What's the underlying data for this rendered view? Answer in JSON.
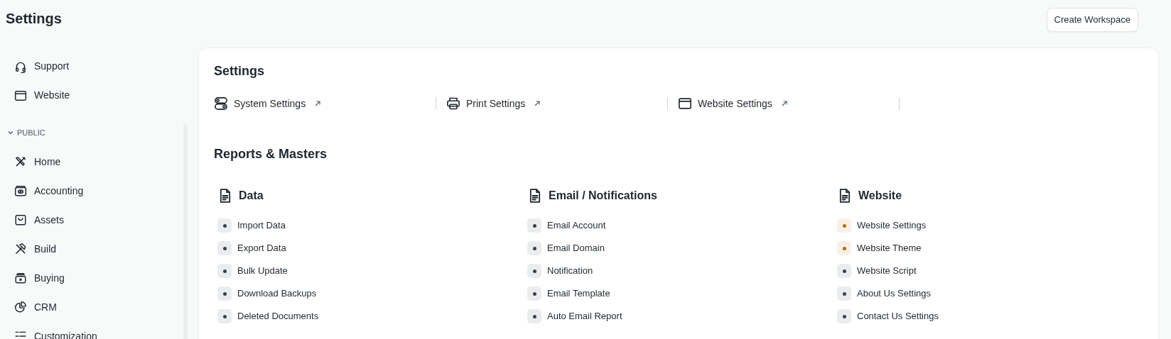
{
  "page_title": "Settings",
  "header_button": "Create Workspace",
  "sidebar": {
    "items": [
      {
        "label": "Support"
      },
      {
        "label": "Website"
      }
    ],
    "section": {
      "label": "PUBLIC",
      "expanded": true,
      "items": [
        {
          "label": "Home"
        },
        {
          "label": "Accounting"
        },
        {
          "label": "Assets"
        },
        {
          "label": "Build"
        },
        {
          "label": "Buying"
        },
        {
          "label": "CRM"
        },
        {
          "label": "Customization"
        }
      ]
    }
  },
  "card": {
    "title": "Settings",
    "shortcuts": [
      {
        "label": "System Settings"
      },
      {
        "label": "Print Settings"
      },
      {
        "label": "Website Settings"
      }
    ],
    "reports_title": "Reports & Masters",
    "groups": [
      {
        "title": "Data",
        "links": [
          {
            "label": "Import Data",
            "color": "#374151"
          },
          {
            "label": "Export Data",
            "color": "#374151"
          },
          {
            "label": "Bulk Update",
            "color": "#374151"
          },
          {
            "label": "Download Backups",
            "color": "#374151"
          },
          {
            "label": "Deleted Documents",
            "color": "#374151"
          }
        ]
      },
      {
        "title": "Email / Notifications",
        "links": [
          {
            "label": "Email Account",
            "color": "#374151"
          },
          {
            "label": "Email Domain",
            "color": "#374151"
          },
          {
            "label": "Notification",
            "color": "#374151"
          },
          {
            "label": "Email Template",
            "color": "#374151"
          },
          {
            "label": "Auto Email Report",
            "color": "#374151"
          }
        ]
      },
      {
        "title": "Website",
        "links": [
          {
            "label": "Website Settings",
            "color": "#b86a0c"
          },
          {
            "label": "Website Theme",
            "color": "#b86a0c"
          },
          {
            "label": "Website Script",
            "color": "#374151"
          },
          {
            "label": "About Us Settings",
            "color": "#374151"
          },
          {
            "label": "Contact Us Settings",
            "color": "#374151"
          }
        ]
      }
    ]
  }
}
